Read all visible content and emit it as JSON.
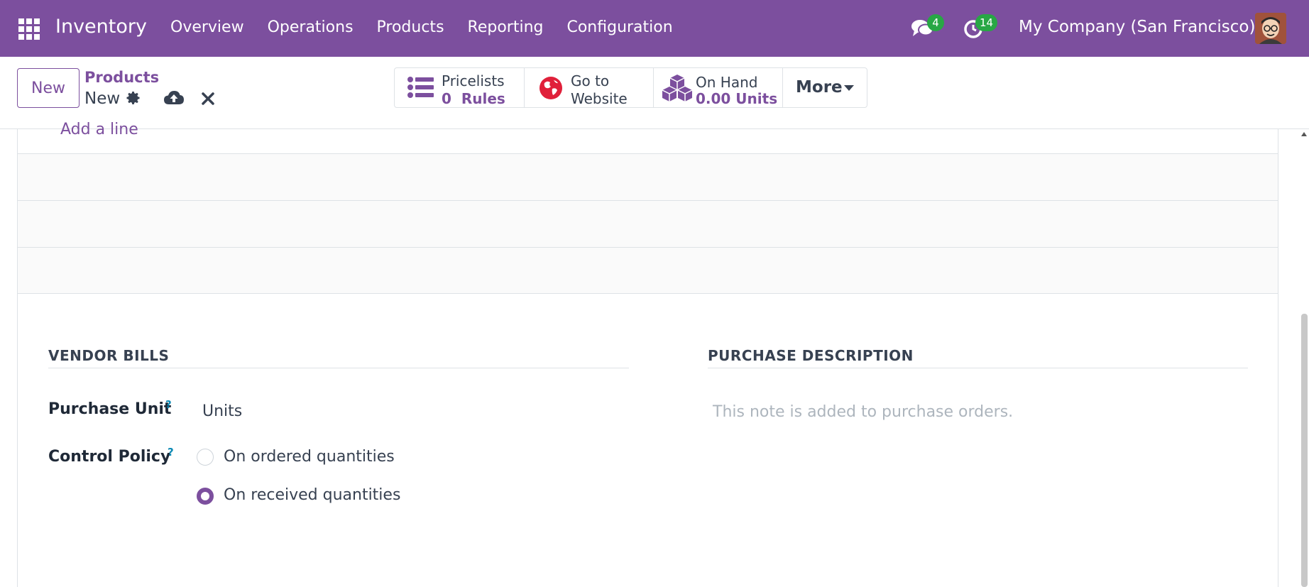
{
  "app": {
    "title": "Inventory",
    "menu": [
      "Overview",
      "Operations",
      "Products",
      "Reporting",
      "Configuration"
    ],
    "chat_count": "4",
    "activity_count": "14",
    "company": "My Company (San Francisco)",
    "brand_color": "#7c4f9e"
  },
  "control": {
    "new_label": "New",
    "breadcrumb_parent": "Products",
    "breadcrumb_current": "New"
  },
  "smart_buttons": {
    "pricelists_l1": "Pricelists",
    "pricelists_l2": "0  Rules",
    "website_l1": "Go to",
    "website_l2": "Website",
    "onhand_l1": "On Hand",
    "onhand_l2": "0.00 Units",
    "more_label": "More"
  },
  "form": {
    "add_line": "Add a line",
    "vendor_bills_title": "VENDOR BILLS",
    "purchase_description_title": "PURCHASE DESCRIPTION",
    "purchase_unit_label": "Purchase Unit",
    "purchase_unit_value": "Units",
    "control_policy_label": "Control Policy",
    "help_mark": "?",
    "policy_options": [
      "On ordered quantities",
      "On received quantities"
    ],
    "policy_selected": "On received quantities",
    "purchase_description_placeholder": "This note is added to purchase orders."
  }
}
